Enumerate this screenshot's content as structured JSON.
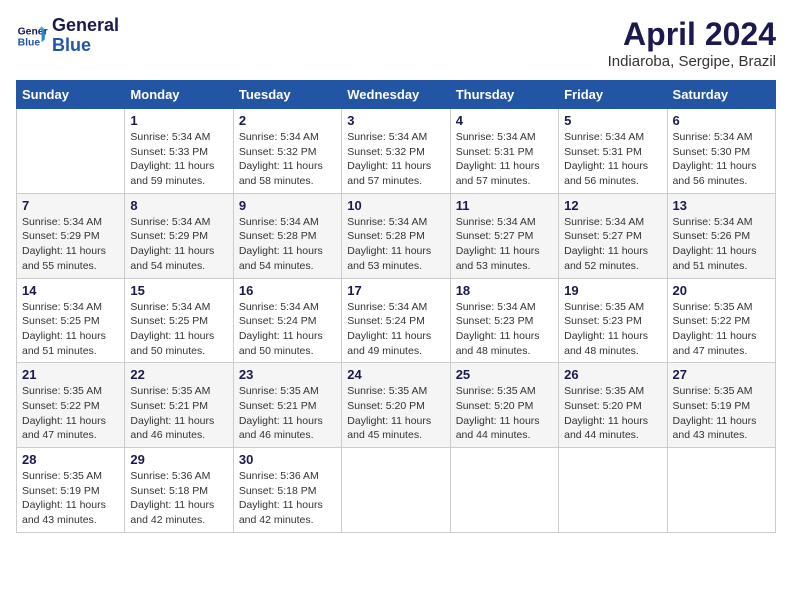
{
  "header": {
    "logo_line1": "General",
    "logo_line2": "Blue",
    "title": "April 2024",
    "subtitle": "Indiaroba, Sergipe, Brazil"
  },
  "columns": [
    "Sunday",
    "Monday",
    "Tuesday",
    "Wednesday",
    "Thursday",
    "Friday",
    "Saturday"
  ],
  "weeks": [
    [
      {
        "day": "",
        "detail": ""
      },
      {
        "day": "1",
        "detail": "Sunrise: 5:34 AM\nSunset: 5:33 PM\nDaylight: 11 hours\nand 59 minutes."
      },
      {
        "day": "2",
        "detail": "Sunrise: 5:34 AM\nSunset: 5:32 PM\nDaylight: 11 hours\nand 58 minutes."
      },
      {
        "day": "3",
        "detail": "Sunrise: 5:34 AM\nSunset: 5:32 PM\nDaylight: 11 hours\nand 57 minutes."
      },
      {
        "day": "4",
        "detail": "Sunrise: 5:34 AM\nSunset: 5:31 PM\nDaylight: 11 hours\nand 57 minutes."
      },
      {
        "day": "5",
        "detail": "Sunrise: 5:34 AM\nSunset: 5:31 PM\nDaylight: 11 hours\nand 56 minutes."
      },
      {
        "day": "6",
        "detail": "Sunrise: 5:34 AM\nSunset: 5:30 PM\nDaylight: 11 hours\nand 56 minutes."
      }
    ],
    [
      {
        "day": "7",
        "detail": "Sunrise: 5:34 AM\nSunset: 5:29 PM\nDaylight: 11 hours\nand 55 minutes."
      },
      {
        "day": "8",
        "detail": "Sunrise: 5:34 AM\nSunset: 5:29 PM\nDaylight: 11 hours\nand 54 minutes."
      },
      {
        "day": "9",
        "detail": "Sunrise: 5:34 AM\nSunset: 5:28 PM\nDaylight: 11 hours\nand 54 minutes."
      },
      {
        "day": "10",
        "detail": "Sunrise: 5:34 AM\nSunset: 5:28 PM\nDaylight: 11 hours\nand 53 minutes."
      },
      {
        "day": "11",
        "detail": "Sunrise: 5:34 AM\nSunset: 5:27 PM\nDaylight: 11 hours\nand 53 minutes."
      },
      {
        "day": "12",
        "detail": "Sunrise: 5:34 AM\nSunset: 5:27 PM\nDaylight: 11 hours\nand 52 minutes."
      },
      {
        "day": "13",
        "detail": "Sunrise: 5:34 AM\nSunset: 5:26 PM\nDaylight: 11 hours\nand 51 minutes."
      }
    ],
    [
      {
        "day": "14",
        "detail": "Sunrise: 5:34 AM\nSunset: 5:25 PM\nDaylight: 11 hours\nand 51 minutes."
      },
      {
        "day": "15",
        "detail": "Sunrise: 5:34 AM\nSunset: 5:25 PM\nDaylight: 11 hours\nand 50 minutes."
      },
      {
        "day": "16",
        "detail": "Sunrise: 5:34 AM\nSunset: 5:24 PM\nDaylight: 11 hours\nand 50 minutes."
      },
      {
        "day": "17",
        "detail": "Sunrise: 5:34 AM\nSunset: 5:24 PM\nDaylight: 11 hours\nand 49 minutes."
      },
      {
        "day": "18",
        "detail": "Sunrise: 5:34 AM\nSunset: 5:23 PM\nDaylight: 11 hours\nand 48 minutes."
      },
      {
        "day": "19",
        "detail": "Sunrise: 5:35 AM\nSunset: 5:23 PM\nDaylight: 11 hours\nand 48 minutes."
      },
      {
        "day": "20",
        "detail": "Sunrise: 5:35 AM\nSunset: 5:22 PM\nDaylight: 11 hours\nand 47 minutes."
      }
    ],
    [
      {
        "day": "21",
        "detail": "Sunrise: 5:35 AM\nSunset: 5:22 PM\nDaylight: 11 hours\nand 47 minutes."
      },
      {
        "day": "22",
        "detail": "Sunrise: 5:35 AM\nSunset: 5:21 PM\nDaylight: 11 hours\nand 46 minutes."
      },
      {
        "day": "23",
        "detail": "Sunrise: 5:35 AM\nSunset: 5:21 PM\nDaylight: 11 hours\nand 46 minutes."
      },
      {
        "day": "24",
        "detail": "Sunrise: 5:35 AM\nSunset: 5:20 PM\nDaylight: 11 hours\nand 45 minutes."
      },
      {
        "day": "25",
        "detail": "Sunrise: 5:35 AM\nSunset: 5:20 PM\nDaylight: 11 hours\nand 44 minutes."
      },
      {
        "day": "26",
        "detail": "Sunrise: 5:35 AM\nSunset: 5:20 PM\nDaylight: 11 hours\nand 44 minutes."
      },
      {
        "day": "27",
        "detail": "Sunrise: 5:35 AM\nSunset: 5:19 PM\nDaylight: 11 hours\nand 43 minutes."
      }
    ],
    [
      {
        "day": "28",
        "detail": "Sunrise: 5:35 AM\nSunset: 5:19 PM\nDaylight: 11 hours\nand 43 minutes."
      },
      {
        "day": "29",
        "detail": "Sunrise: 5:36 AM\nSunset: 5:18 PM\nDaylight: 11 hours\nand 42 minutes."
      },
      {
        "day": "30",
        "detail": "Sunrise: 5:36 AM\nSunset: 5:18 PM\nDaylight: 11 hours\nand 42 minutes."
      },
      {
        "day": "",
        "detail": ""
      },
      {
        "day": "",
        "detail": ""
      },
      {
        "day": "",
        "detail": ""
      },
      {
        "day": "",
        "detail": ""
      }
    ]
  ]
}
